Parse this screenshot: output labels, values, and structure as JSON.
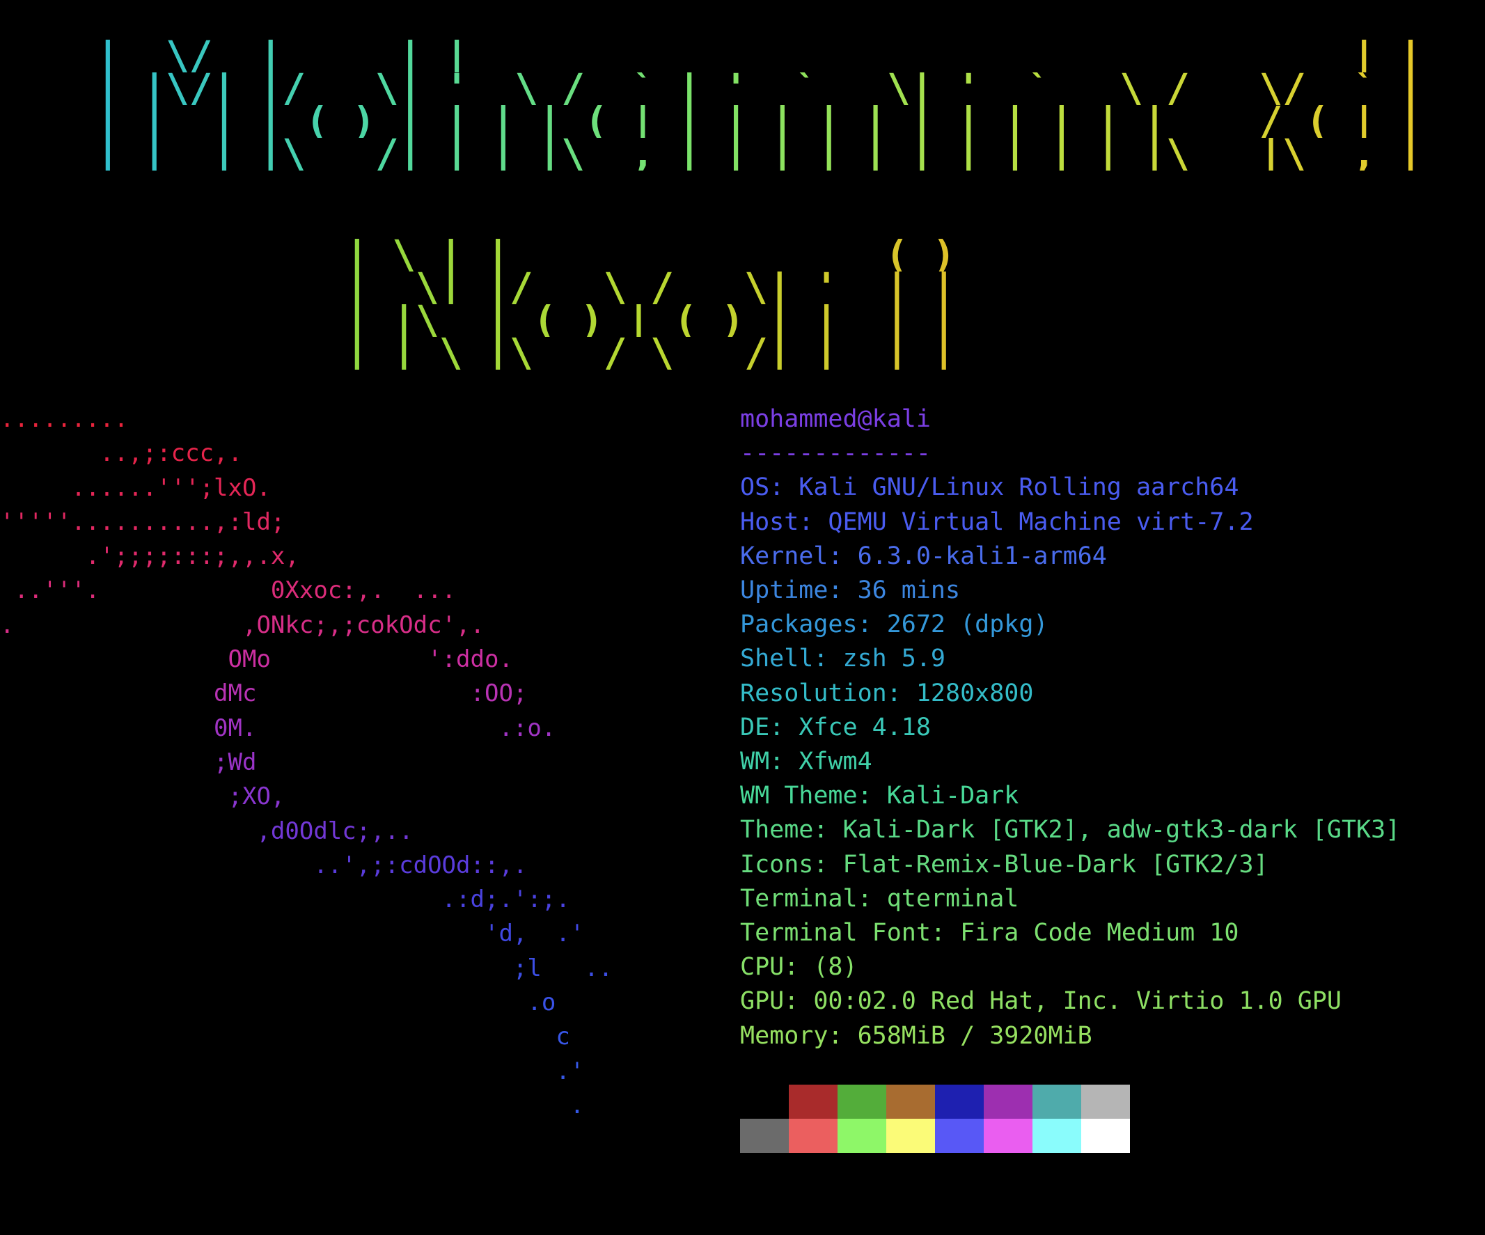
{
  "banner": {
    "name_lines": [
      " __  __       _                                        _ ",
      "|  \\/  | ___ | |__   __ _ _ __ ___  _ __ ___   ___  __| |",
      "| |\\/| |/ _ \\| '_ \\ / _` | '_ ` _ \\| '_ ` _ \\ / _ \\/ _` |",
      "| |  | | (_) | | | | (_| | | | | | | | | | | |  __/ (_| |",
      "|_|  |_|\\___/|_| |_|\\__,_|_| |_| |_|_| |_| |_|\\___|\\__,_|"
    ],
    "surname_lines": [
      " _   _                  _ ",
      "| \\ | | ___   ___  _ __(_)",
      "|  \\| |/ _ \\ / _ \\| '__| |",
      "| |\\  | (_) | (_) | |  | |",
      "|_| \\_|\\___/ \\___/|_|  |_|"
    ]
  },
  "logo": {
    "lines": [
      ".........",
      "       ..,;:ccc,.",
      "     ......''';lxO.",
      "'''''..........,:ld;",
      "      .';;;;:::;,,.x,",
      " ..'''.            0Xxoc:,.  ...",
      ".                ,ONkc;,;cokOdc',.",
      "                OMo           ':ddo.",
      "               dMc               :OO;",
      "               0M.                 .:o.",
      "               ;Wd",
      "                ;XO,",
      "                  ,d0Odlc;,..",
      "                      ..',;:cdOOd::,.",
      "                               .:d;.':;.",
      "                                  'd,  .'",
      "                                    ;l   ..",
      "                                     .o",
      "                                       c",
      "                                       .'",
      "                                        ."
    ],
    "colors": [
      "#e8243c",
      "#e6244a",
      "#e42656",
      "#e22862",
      "#e02a6c",
      "#dc2c7a",
      "#d82e88",
      "#cc2fa2",
      "#b833b4",
      "#a034c4",
      "#9a34c8",
      "#8a36d0",
      "#7238d6",
      "#5a3cdc",
      "#4a42e0",
      "#4048e2",
      "#3c4ee4",
      "#3a52e6",
      "#3856e6",
      "#3658e6",
      "#3458e6"
    ]
  },
  "info": {
    "header": "mohammed@kali",
    "separator": "-------------",
    "rows": [
      "OS: Kali GNU/Linux Rolling aarch64",
      "Host: QEMU Virtual Machine virt-7.2",
      "Kernel: 6.3.0-kali1-arm64",
      "Uptime: 36 mins",
      "Packages: 2672 (dpkg)",
      "Shell: zsh 5.9",
      "Resolution: 1280x800",
      "DE: Xfce 4.18",
      "WM: Xfwm4",
      "WM Theme: Kali-Dark",
      "Theme: Kali-Dark [GTK2], adw-gtk3-dark [GTK3]",
      "Icons: Flat-Remix-Blue-Dark [GTK2/3]",
      "Terminal: qterminal",
      "Terminal Font: Fira Code Medium 10",
      "CPU: (8)",
      "GPU: 00:02.0 Red Hat, Inc. Virtio 1.0 GPU",
      "Memory: 658MiB / 3920MiB"
    ],
    "header_color": "#7b3fe4",
    "row_colors": [
      "#4a5cf0",
      "#4a5cf0",
      "#4a6cec",
      "#3c86e0",
      "#3498da",
      "#34aad4",
      "#34bcc8",
      "#3ac8b8",
      "#40d0a8",
      "#48d898",
      "#5ada88",
      "#66dc80",
      "#70de78",
      "#7ce070",
      "#86e068",
      "#8ee064",
      "#96e060"
    ]
  },
  "palette": {
    "normal": [
      "#000000",
      "#a92b2b",
      "#53ad3a",
      "#a86c30",
      "#1e20b0",
      "#9d2fb0",
      "#4fabab",
      "#b5b5b5"
    ],
    "bright": [
      "#6b6b6b",
      "#eb5f5f",
      "#8ef768",
      "#fbfb78",
      "#5858f6",
      "#ea5ef0",
      "#8afcfc",
      "#ffffff"
    ]
  }
}
